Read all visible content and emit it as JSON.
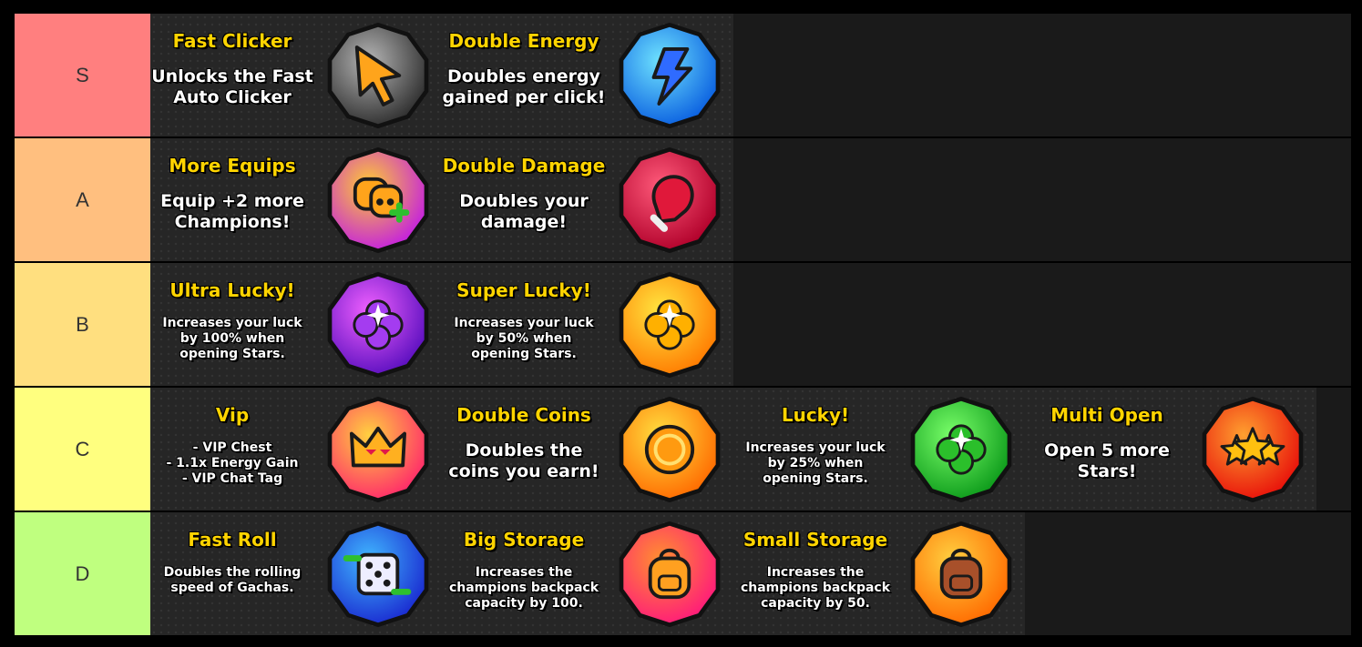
{
  "tiers": [
    {
      "label": "S",
      "color": "#ff7f7f",
      "items": [
        {
          "title": "Fast Clicker",
          "desc": "Unlocks the Fast\nAuto Clicker",
          "size": "big",
          "icon": "cursor-icon",
          "bg1": "#b5b5b5",
          "bg2": "#2e2e2e",
          "fg": "#ffa41b"
        },
        {
          "title": "Double Energy",
          "desc": "Doubles energy\ngained per click!",
          "size": "big",
          "icon": "lightning-icon",
          "bg1": "#6fe3ff",
          "bg2": "#0a5fe0",
          "fg": "#2f6bff"
        }
      ]
    },
    {
      "label": "A",
      "color": "#ffbf7f",
      "items": [
        {
          "title": "More Equips",
          "desc": "Equip +2 more\nChampions!",
          "size": "big",
          "icon": "champions-plus-icon",
          "bg1": "#ffcc33",
          "bg2": "#c41fe0",
          "fg": "#ffa41b"
        },
        {
          "title": "Double Damage",
          "desc": "Doubles your\ndamage!",
          "size": "big",
          "icon": "boxing-glove-icon",
          "bg1": "#ff5a7a",
          "bg2": "#b0002a",
          "fg": "#e0183a"
        }
      ]
    },
    {
      "label": "B",
      "color": "#ffdf7f",
      "items": [
        {
          "title": "Ultra Lucky!",
          "desc": "Increases your luck\nby 100% when\nopening Stars.",
          "size": "small",
          "icon": "purple-clover-icon",
          "bg1": "#f060ff",
          "bg2": "#5a0fbf",
          "fg": "#a43cf0"
        },
        {
          "title": "Super Lucky!",
          "desc": "Increases your luck\nby 50% when\nopening Stars.",
          "size": "small",
          "icon": "gold-clover-icon",
          "bg1": "#ffe640",
          "bg2": "#ff7a00",
          "fg": "#ffb000"
        }
      ]
    },
    {
      "label": "C",
      "color": "#ffff7f",
      "items": [
        {
          "title": "Vip",
          "desc": "- VIP Chest\n- 1.1x Energy Gain\n- VIP Chat Tag",
          "size": "small",
          "icon": "crown-icon",
          "bg1": "#ffd040",
          "bg2": "#ff2a6a",
          "fg": "#ffb020"
        },
        {
          "title": "Double Coins",
          "desc": "Doubles the\ncoins you earn!",
          "size": "big",
          "icon": "coin-icon",
          "bg1": "#ffe040",
          "bg2": "#ff6a00",
          "fg": "#ff9a10"
        },
        {
          "title": "Lucky!",
          "desc": "Increases your luck\nby 25% when\nopening Stars.",
          "size": "small",
          "icon": "green-clover-icon",
          "bg1": "#7aff6a",
          "bg2": "#0c9a1a",
          "fg": "#2bbf2b"
        },
        {
          "title": "Multi Open",
          "desc": "Open 5 more\nStars!",
          "size": "big",
          "icon": "stars-icon",
          "bg1": "#ffa030",
          "bg2": "#e8100a",
          "fg": "#ffc010"
        }
      ]
    },
    {
      "label": "D",
      "color": "#bfff7f",
      "items": [
        {
          "title": "Fast Roll",
          "desc": "Doubles the rolling\nspeed of Gachas.",
          "size": "small",
          "icon": "dice-icon",
          "bg1": "#40b8ff",
          "bg2": "#1a2ad0",
          "fg": "#eeeeff"
        },
        {
          "title": "Big Storage",
          "desc": "Increases the\nchampions backpack\ncapacity by 100.",
          "size": "small",
          "icon": "orange-backpack-icon",
          "bg1": "#ff9030",
          "bg2": "#ff1a7a",
          "fg": "#ffa020"
        },
        {
          "title": "Small Storage",
          "desc": "Increases the\nchampions backpack\ncapacity by 50.",
          "size": "small",
          "icon": "brown-backpack-icon",
          "bg1": "#ffd040",
          "bg2": "#ff6a00",
          "fg": "#a8502a"
        }
      ]
    }
  ]
}
